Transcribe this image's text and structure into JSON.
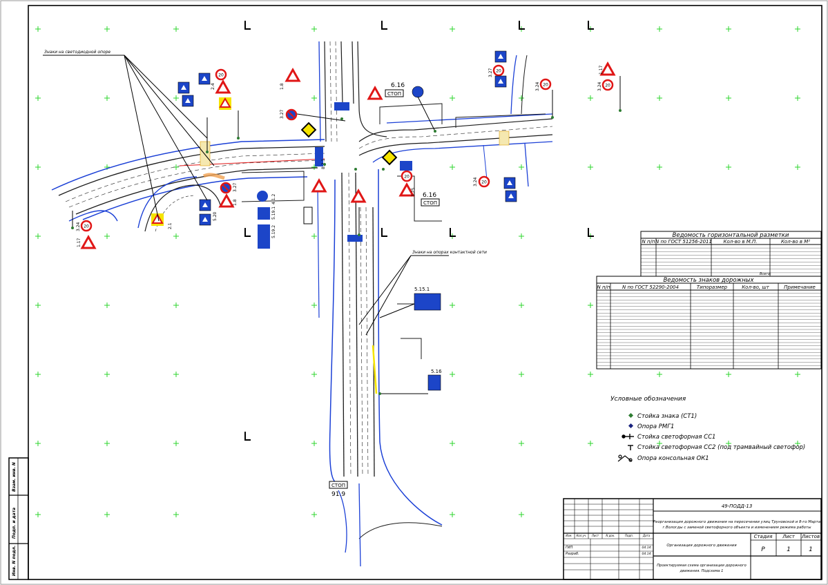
{
  "callouts": {
    "signs_on_lighting_poles": "Знаки на светодиодной опоре",
    "signs_on_tram_poles": "Знаки на опорах контактной сети",
    "sign_6_16_a": "6.16",
    "sign_6_16_b": "6.16",
    "stop_a": "СТОП",
    "stop_b": "СТОП",
    "stop_c": "СТОП",
    "sign_5_15_1": "5.15.1",
    "sign_5_16": "5.16",
    "sign_5_19_1": "5.19.1",
    "sign_5_19_2": "5.19.2",
    "sign_4_1_2": "4.1.2",
    "sign_1_17": "1.17",
    "sign_3_24": "3.24",
    "sign_3_27": "3.27",
    "sign_3_25": "3.25",
    "sign_2_4": "2.4",
    "sign_1_8": "1.8",
    "sign_2_1": "2.1",
    "sign_5_20": "5.20",
    "sign_8_2_1": "8.2.1",
    "sign_91_9": "91.9"
  },
  "marking_table": {
    "title": "Ведомость горизонтальной разметки",
    "headers": [
      "N п/п",
      "N по ГОСТ 51256-2011",
      "Кол-во в М.П.",
      "Кол-во в М²"
    ],
    "row_count": 9,
    "total_label": "Всего:"
  },
  "signs_table": {
    "title": "Ведомость знаков дорожных",
    "headers": [
      "N п/п",
      "N по ГОСТ 52290-2004",
      "Типоразмер",
      "Кол-во, шт",
      "Примечание"
    ],
    "row_count": 24
  },
  "legend": {
    "title": "Условные обозначения",
    "items": [
      {
        "label": "Стойка знака (СТ1)",
        "icon": "sign-post-icon"
      },
      {
        "label": "Опора РМГ1",
        "icon": "pole-icon"
      },
      {
        "label": "Стойка светофорная СС1",
        "icon": "traffic-light-stand-icon"
      },
      {
        "label": "Стойка светофорная СС2 (под трамвайный светофор)",
        "icon": "tram-light-stand-icon"
      },
      {
        "label": "Опора консольная ОК1",
        "icon": "cantilever-pole-icon"
      }
    ]
  },
  "title_block": {
    "code": "49-ПОДД-13",
    "project_name": "Реорганизация дорожного движения на пересечении улиц Труновской и 8-го Марта г.Вологды с заменой светофорного объекта и изменением режима работы",
    "col_headers": [
      "Изм.",
      "Кол.уч.",
      "Лист",
      "N док.",
      "Подп.",
      "Дата"
    ],
    "roles": [
      {
        "role": "ГИП",
        "date": "04.14"
      },
      {
        "role": "Разраб.",
        "date": "04.14"
      }
    ],
    "stage_label": "Стадия",
    "sheet_label": "Лист",
    "sheets_label": "Листов",
    "stage_value": "Р",
    "sheet_value": "1",
    "sheets_value": "1",
    "section_name": "Организация дорожного движения",
    "drawing_name": "Проектируемая схема организации дорожного движения. Подсхема 1"
  },
  "side_stamp": {
    "labels": [
      "Взам. инв. N",
      "Подп. и дата",
      "Инв. N подл."
    ]
  },
  "colors": {
    "road_line": "#1b1b1b",
    "curb_blue": "#1a3fd6",
    "grid_cross": "#2bd42b",
    "sign_red": "#e01616",
    "sign_blue": "#1c45c8",
    "sign_yellow": "#f5e400"
  }
}
